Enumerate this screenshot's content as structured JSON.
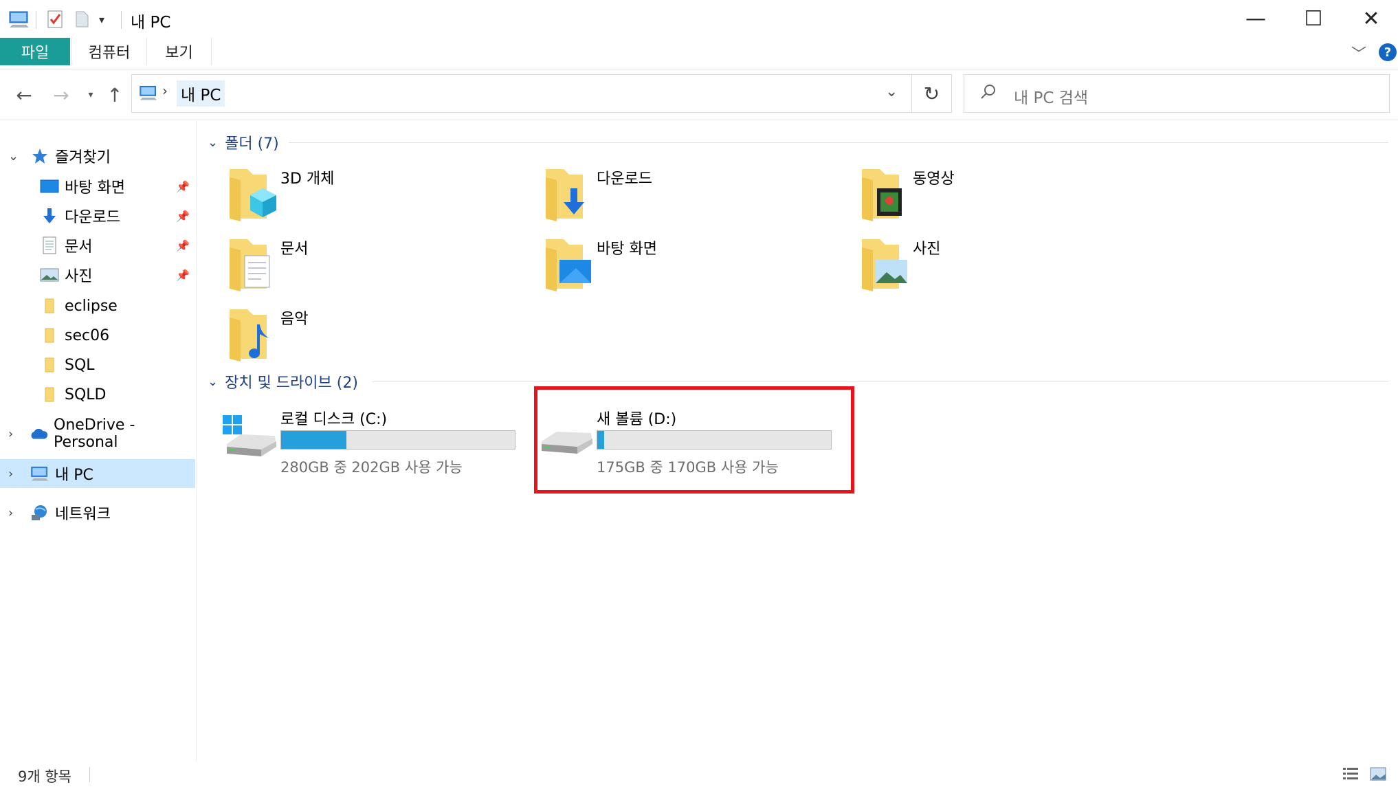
{
  "window": {
    "title": "내 PC",
    "minimize": "—",
    "maximize": "☐",
    "close": "✕"
  },
  "ribbon": {
    "tabs": [
      "파일",
      "컴퓨터",
      "보기"
    ],
    "help": "?"
  },
  "navigation": {
    "address_crumb": "내 PC",
    "search_placeholder": "내 PC 검색"
  },
  "sidebar": {
    "quick_access": "즐겨찾기",
    "pinned": [
      "바탕 화면",
      "다운로드",
      "문서",
      "사진"
    ],
    "folders": [
      "eclipse",
      "sec06",
      "SQL",
      "SQLD"
    ],
    "onedrive": "OneDrive - Personal",
    "this_pc": "내 PC",
    "network": "네트워크"
  },
  "content": {
    "folders_header": "폴더 (7)",
    "folders": [
      "3D 개체",
      "다운로드",
      "동영상",
      "문서",
      "바탕 화면",
      "사진",
      "음악"
    ],
    "drives_header": "장치 및 드라이브 (2)",
    "drives": [
      {
        "name": "로컬 디스크 (C:)",
        "info": "280GB 중 202GB 사용 가능",
        "used_fraction": 0.28
      },
      {
        "name": "새 볼륨 (D:)",
        "info": "175GB 중 170GB 사용 가능",
        "used_fraction": 0.03
      }
    ]
  },
  "status": {
    "item_count": "9개 항목"
  },
  "colors": {
    "accent": "#1a9c97",
    "selection": "#cce8ff",
    "bar_fill": "#26a0da",
    "highlight": "#e8141c",
    "group_header": "#1e3f84"
  }
}
